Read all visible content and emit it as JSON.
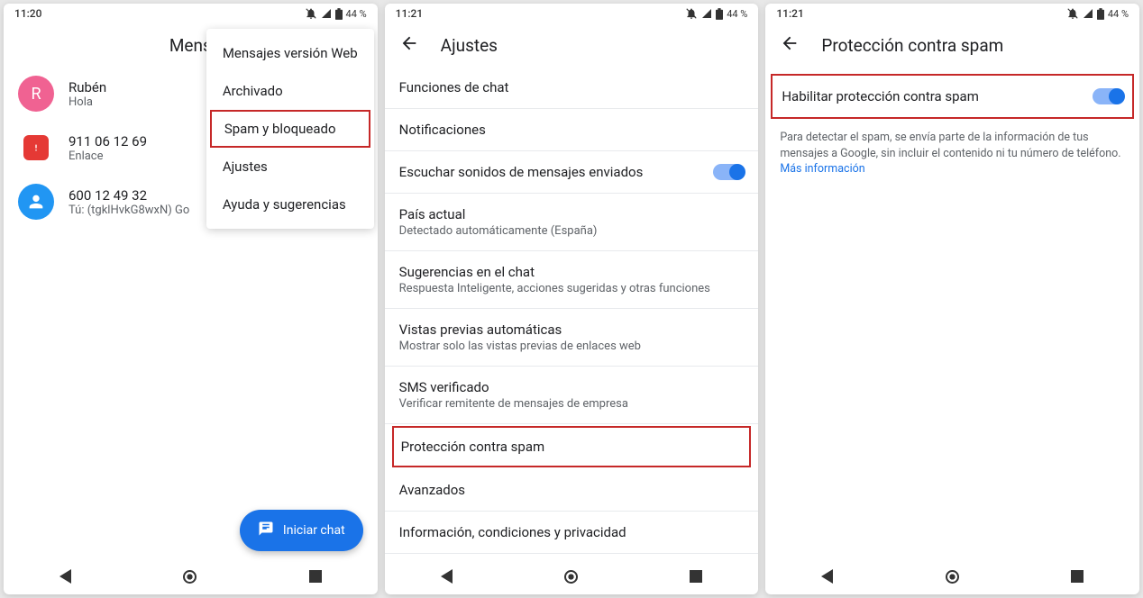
{
  "screen1": {
    "status": {
      "time": "11:20",
      "battery": "44 %"
    },
    "title": "Mens",
    "menu": {
      "items": [
        "Mensajes versión Web",
        "Archivado",
        "Spam y bloqueado",
        "Ajustes",
        "Ayuda y sugerencias"
      ]
    },
    "conversations": [
      {
        "name": "Rubén",
        "preview": "Hola",
        "avatar_letter": "R"
      },
      {
        "name": "911 06 12 69",
        "preview": "Enlace"
      },
      {
        "name": "600 12 49 32",
        "preview": "Tú: (tgklHvkG8wxN) Go"
      }
    ],
    "fab": "Iniciar chat"
  },
  "screen2": {
    "status": {
      "time": "11:21",
      "battery": "44 %"
    },
    "title": "Ajustes",
    "items": [
      {
        "title": "Funciones de chat"
      },
      {
        "title": "Notificaciones"
      },
      {
        "title": "Escuchar sonidos de mensajes enviados",
        "toggle": true
      },
      {
        "title": "País actual",
        "subtitle": "Detectado automáticamente (España)"
      },
      {
        "title": "Sugerencias en el chat",
        "subtitle": "Respuesta Inteligente, acciones sugeridas y otras funciones"
      },
      {
        "title": "Vistas previas automáticas",
        "subtitle": "Mostrar solo las vistas previas de enlaces web"
      },
      {
        "title": "SMS verificado",
        "subtitle": "Verificar remitente de mensajes de empresa"
      },
      {
        "title": "Protección contra spam",
        "highlighted": true
      },
      {
        "title": "Avanzados"
      },
      {
        "title": "Información, condiciones y privacidad"
      }
    ]
  },
  "screen3": {
    "status": {
      "time": "11:21",
      "battery": "44 %"
    },
    "title": "Protección contra spam",
    "toggle_label": "Habilitar protección contra spam",
    "info": "Para detectar el spam, se envía parte de la información de tus mensajes a Google, sin incluir el contenido ni tu número de teléfono. ",
    "link": "Más información"
  }
}
